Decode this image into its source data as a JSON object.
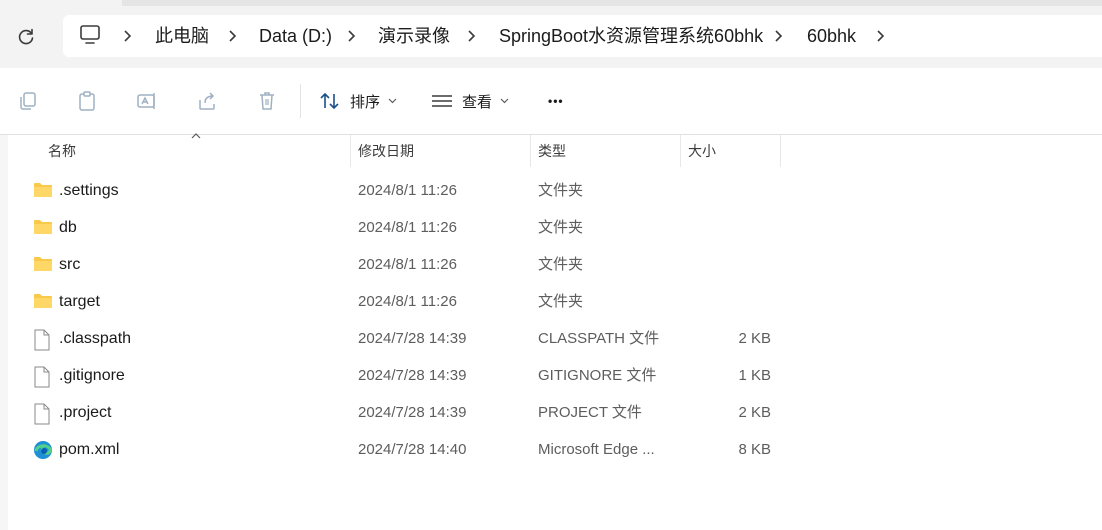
{
  "address_bar": {
    "breadcrumbs": [
      "此电脑",
      "Data (D:)",
      "演示录像",
      "SpringBoot水资源管理系统60bhk",
      "60bhk"
    ]
  },
  "toolbar": {
    "sort_label": "排序",
    "view_label": "查看",
    "more_label": "•••"
  },
  "columns": {
    "name": "名称",
    "date": "修改日期",
    "type": "类型",
    "size": "大小"
  },
  "files": [
    {
      "icon": "folder-icon",
      "name": ".settings",
      "date": "2024/8/1 11:26",
      "type": "文件夹",
      "size": ""
    },
    {
      "icon": "folder-icon",
      "name": "db",
      "date": "2024/8/1 11:26",
      "type": "文件夹",
      "size": ""
    },
    {
      "icon": "folder-icon",
      "name": "src",
      "date": "2024/8/1 11:26",
      "type": "文件夹",
      "size": ""
    },
    {
      "icon": "folder-icon",
      "name": "target",
      "date": "2024/8/1 11:26",
      "type": "文件夹",
      "size": ""
    },
    {
      "icon": "file-icon",
      "name": ".classpath",
      "date": "2024/7/28 14:39",
      "type": "CLASSPATH 文件",
      "size": "2 KB"
    },
    {
      "icon": "file-icon",
      "name": ".gitignore",
      "date": "2024/7/28 14:39",
      "type": "GITIGNORE 文件",
      "size": "1 KB"
    },
    {
      "icon": "file-icon",
      "name": ".project",
      "date": "2024/7/28 14:39",
      "type": "PROJECT 文件",
      "size": "2 KB"
    },
    {
      "icon": "edge-icon",
      "name": "pom.xml",
      "date": "2024/7/28 14:40",
      "type": "Microsoft Edge ...",
      "size": "8 KB"
    }
  ],
  "colors": {
    "folder": "#f8c94a",
    "accent": "#0067c0",
    "toolbar_icon": "#8a9cb0"
  }
}
